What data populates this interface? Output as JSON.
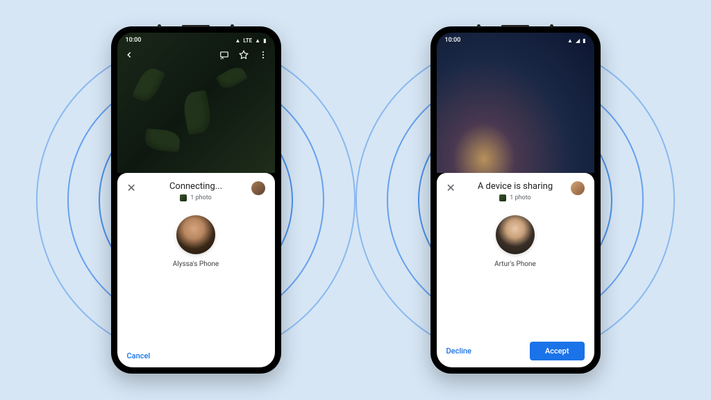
{
  "phone_left": {
    "status": {
      "time": "10:00",
      "network": "LTE"
    },
    "sheet": {
      "title": "Connecting...",
      "subtext": "1 photo",
      "target_name": "Alyssa's Phone",
      "cancel_label": "Cancel"
    }
  },
  "phone_right": {
    "status": {
      "time": "10:00"
    },
    "sheet": {
      "title": "A device is sharing",
      "subtext": "1 photo",
      "target_name": "Artur's Phone",
      "decline_label": "Decline",
      "accept_label": "Accept"
    }
  }
}
